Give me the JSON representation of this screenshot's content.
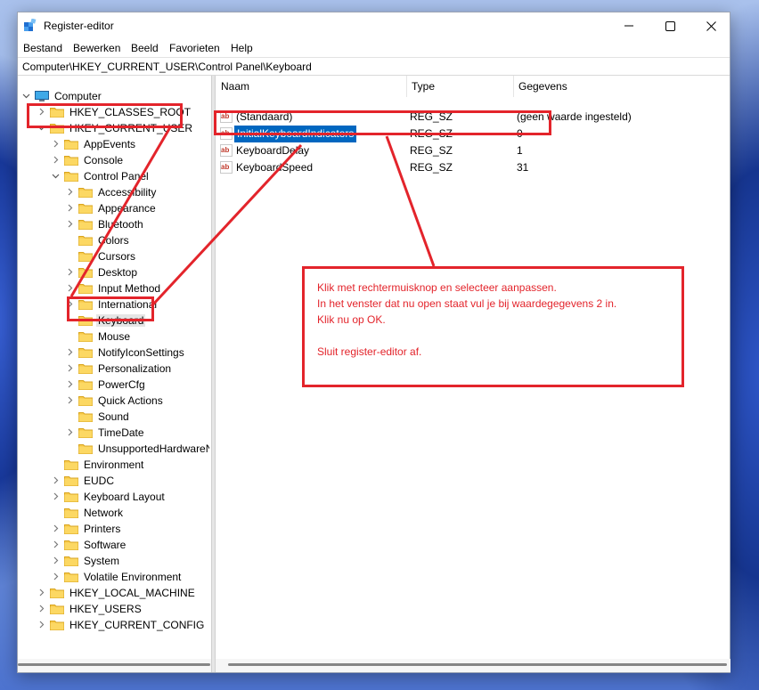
{
  "window": {
    "title": "Register-editor",
    "app_icon": "registry-icon"
  },
  "menu": [
    "Bestand",
    "Bewerken",
    "Beeld",
    "Favorieten",
    "Help"
  ],
  "address": "Computer\\HKEY_CURRENT_USER\\Control Panel\\Keyboard",
  "tree": {
    "root": "Computer",
    "items": [
      {
        "label": "HKEY_CLASSES_ROOT",
        "depth": 1,
        "expander": "collapsed"
      },
      {
        "label": "HKEY_CURRENT_USER",
        "depth": 1,
        "expander": "expanded"
      },
      {
        "label": "AppEvents",
        "depth": 2,
        "expander": "collapsed"
      },
      {
        "label": "Console",
        "depth": 2,
        "expander": "collapsed"
      },
      {
        "label": "Control Panel",
        "depth": 2,
        "expander": "expanded"
      },
      {
        "label": "Accessibility",
        "depth": 3,
        "expander": "collapsed"
      },
      {
        "label": "Appearance",
        "depth": 3,
        "expander": "collapsed"
      },
      {
        "label": "Bluetooth",
        "depth": 3,
        "expander": "collapsed"
      },
      {
        "label": "Colors",
        "depth": 3,
        "expander": "none"
      },
      {
        "label": "Cursors",
        "depth": 3,
        "expander": "none"
      },
      {
        "label": "Desktop",
        "depth": 3,
        "expander": "collapsed"
      },
      {
        "label": "Input Method",
        "depth": 3,
        "expander": "collapsed"
      },
      {
        "label": "International",
        "depth": 3,
        "expander": "collapsed"
      },
      {
        "label": "Keyboard",
        "depth": 3,
        "expander": "none",
        "selected": true
      },
      {
        "label": "Mouse",
        "depth": 3,
        "expander": "none"
      },
      {
        "label": "NotifyIconSettings",
        "depth": 3,
        "expander": "collapsed"
      },
      {
        "label": "Personalization",
        "depth": 3,
        "expander": "collapsed"
      },
      {
        "label": "PowerCfg",
        "depth": 3,
        "expander": "collapsed"
      },
      {
        "label": "Quick Actions",
        "depth": 3,
        "expander": "collapsed"
      },
      {
        "label": "Sound",
        "depth": 3,
        "expander": "none"
      },
      {
        "label": "TimeDate",
        "depth": 3,
        "expander": "collapsed"
      },
      {
        "label": "UnsupportedHardwareN",
        "depth": 3,
        "expander": "none"
      },
      {
        "label": "Environment",
        "depth": 2,
        "expander": "none"
      },
      {
        "label": "EUDC",
        "depth": 2,
        "expander": "collapsed"
      },
      {
        "label": "Keyboard Layout",
        "depth": 2,
        "expander": "collapsed"
      },
      {
        "label": "Network",
        "depth": 2,
        "expander": "none"
      },
      {
        "label": "Printers",
        "depth": 2,
        "expander": "collapsed"
      },
      {
        "label": "Software",
        "depth": 2,
        "expander": "collapsed"
      },
      {
        "label": "System",
        "depth": 2,
        "expander": "collapsed"
      },
      {
        "label": "Volatile Environment",
        "depth": 2,
        "expander": "collapsed"
      },
      {
        "label": "HKEY_LOCAL_MACHINE",
        "depth": 1,
        "expander": "collapsed"
      },
      {
        "label": "HKEY_USERS",
        "depth": 1,
        "expander": "collapsed"
      },
      {
        "label": "HKEY_CURRENT_CONFIG",
        "depth": 1,
        "expander": "collapsed"
      }
    ]
  },
  "list": {
    "columns": [
      "Naam",
      "Type",
      "Gegevens"
    ],
    "rows": [
      {
        "name": "(Standaard)",
        "type": "REG_SZ",
        "data": "(geen waarde ingesteld)"
      },
      {
        "name": "InitialKeyboardIndicators",
        "type": "REG_SZ",
        "data": "0",
        "selected": true
      },
      {
        "name": "KeyboardDelay",
        "type": "REG_SZ",
        "data": "1"
      },
      {
        "name": "KeyboardSpeed",
        "type": "REG_SZ",
        "data": "31"
      }
    ]
  },
  "annotation": {
    "lines": [
      "Klik met rechtermuisknop en selecteer aanpassen.",
      "In het venster dat nu open staat vul je bij waardegegevens  2 in.",
      "Klik nu op OK.",
      "",
      "Sluit register-editor af."
    ],
    "color": "#e3242b"
  },
  "colors": {
    "selection": "#0067c0",
    "folder": "#f7c948",
    "annotation": "#e3242b"
  }
}
